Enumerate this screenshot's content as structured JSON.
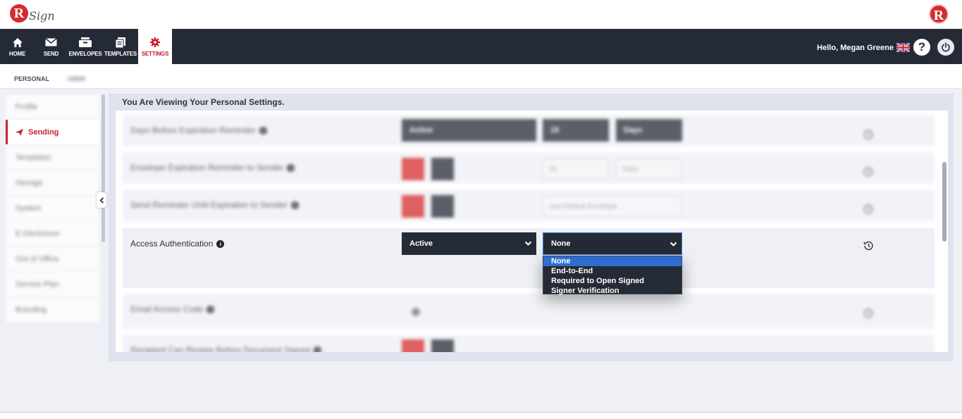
{
  "brand": {
    "logo_letter": "R",
    "logo_text": "Sign",
    "accent_color": "#d52b2b",
    "nav_bg": "#252b36"
  },
  "nav": {
    "items": [
      {
        "label": "HOME",
        "icon": "home-icon"
      },
      {
        "label": "SEND",
        "icon": "mail-icon"
      },
      {
        "label": "ENVELOPES",
        "icon": "envelopes-icon"
      },
      {
        "label": "TEMPLATES",
        "icon": "templates-icon"
      },
      {
        "label": "SETTINGS",
        "icon": "gear-icon",
        "active": true
      }
    ],
    "greeting": "Hello,",
    "user_name": "Megan Greene",
    "help_label": "?",
    "flag_icon": "uk-flag-icon",
    "power_icon": "power-icon"
  },
  "subtabs": {
    "personal": "PERSONAL",
    "second": "USER"
  },
  "sidebar": {
    "items": [
      {
        "label": "Profile"
      },
      {
        "label": "Sending",
        "active": true
      },
      {
        "label": "Templates"
      },
      {
        "label": "Storage"
      },
      {
        "label": "System"
      },
      {
        "label": "E-Disclosure"
      },
      {
        "label": "Out of Office"
      },
      {
        "label": "Service Plan"
      },
      {
        "label": "Branding"
      }
    ]
  },
  "main": {
    "title": "You Are Viewing Your Personal Settings.",
    "rows": [
      {
        "label": "Days Before Expiration Reminder",
        "blurred": true,
        "select1": "Active",
        "select2": "15",
        "select3": "Days"
      },
      {
        "label": "Envelope Expiration Reminder to Sender",
        "blurred": true,
        "select2": "15",
        "select3": "Days"
      },
      {
        "label": "Send Reminder Until Expiration to Sender",
        "blurred": true,
        "select2": "Use Default Envelope"
      },
      {
        "label": "Access Authentication",
        "blurred": false,
        "select1": "Active",
        "select2": "None"
      },
      {
        "label": "Email Access Code",
        "blurred": true
      },
      {
        "label": "Recipient Can Review Before Document Signed",
        "blurred": true
      }
    ],
    "dropdown_options": [
      {
        "label": "None",
        "selected": true
      },
      {
        "label": "End-to-End"
      },
      {
        "label": "Required to Open Signed"
      },
      {
        "label": "Signer Verification"
      }
    ]
  }
}
